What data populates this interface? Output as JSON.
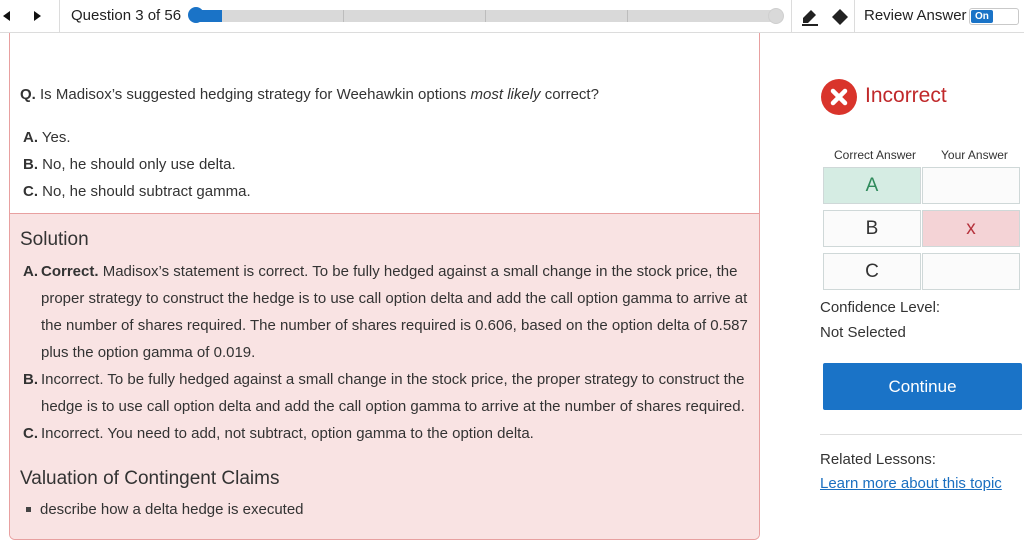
{
  "header": {
    "question_counter": "Question 3 of 56",
    "progress_fraction": 0.054,
    "review_answer_label": "Review Answer",
    "review_toggle_state": "On",
    "icons": [
      "prev-arrow-icon",
      "next-arrow-icon",
      "highlighter-icon",
      "eraser-icon"
    ]
  },
  "question": {
    "prefix": "Q.",
    "text_before": "Is Madisox’s suggested hedging strategy for Weehawkin options ",
    "text_emphasis": "most likely",
    "text_after": " correct?",
    "options": [
      {
        "letter": "A.",
        "text": "Yes."
      },
      {
        "letter": "B.",
        "text": "No, he should only use delta."
      },
      {
        "letter": "C.",
        "text": "No, he should subtract gamma."
      }
    ]
  },
  "solution": {
    "title": "Solution",
    "items": [
      {
        "letter": "A.",
        "verdict": "Correct.",
        "text": " Madisox’s statement is correct. To be fully hedged against a small change in the stock price, the proper strategy to construct the hedge is to use call option delta and add the call option gamma to arrive at the number of shares required. The number of shares required is 0.606, based on the option delta of 0.587 plus the option gamma of 0.019."
      },
      {
        "letter": "B.",
        "verdict": "",
        "text": "Incorrect. To be fully hedged against a small change in the stock price, the proper strategy to construct the hedge is to use call option delta and add the call option gamma to arrive at the number of shares required."
      },
      {
        "letter": "C.",
        "verdict": "",
        "text": "Incorrect. You need to add, not subtract, option gamma to the option delta."
      }
    ],
    "topic_title": "Valuation of Contingent Claims",
    "topic_bullets": [
      "describe how a delta hedge is executed"
    ]
  },
  "result": {
    "status": "Incorrect",
    "status_color": "#c0282a",
    "correct_answer_header": "Correct Answer",
    "your_answer_header": "Your Answer",
    "rows": [
      {
        "correct": "A",
        "yours": ""
      },
      {
        "correct": "B",
        "yours": "x"
      },
      {
        "correct": "C",
        "yours": ""
      }
    ],
    "confidence_label": "Confidence Level:",
    "confidence_value": "Not Selected",
    "continue_label": "Continue",
    "related_label": "Related Lessons:",
    "related_link": "Learn more about this topic"
  },
  "colors": {
    "accent": "#1a73c7",
    "solution_bg": "#f9e3e3",
    "correct_cell": "#d5ece3",
    "wrong_cell": "#f4d3d6"
  }
}
